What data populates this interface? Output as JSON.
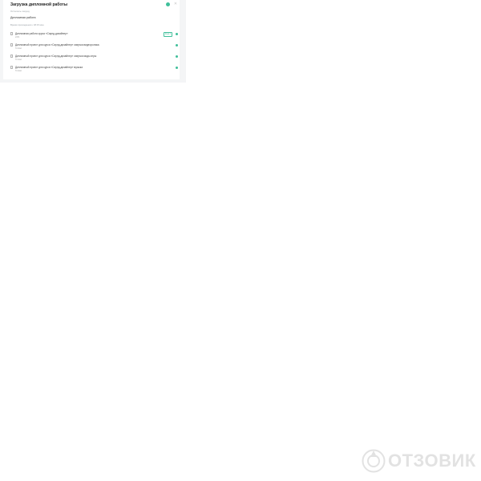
{
  "upload": {
    "title": "Загрузка дипломной работы",
    "subtitle": "Осталось секунд",
    "section_title": "Дипломная работа",
    "section_meta": "Время прохождения • 48:15 мин",
    "files": [
      {
        "name": "Дипломная работа курса «Саунд-дизайнер»",
        "status": "22%",
        "badge": "Ещё 1"
      },
      {
        "name": "Дипломный проект для курса «Саунд-дизайнер» озвучка видеоролика",
        "status": "Готово",
        "badge": ""
      },
      {
        "name": "Дипломный проект для курса «Саунд-дизайнер» озвучка моды игры",
        "status": "Готово",
        "badge": ""
      },
      {
        "name": "Дипломный проект для курса «Саунд-дизайнер» музыка",
        "status": "Готово",
        "badge": ""
      }
    ]
  },
  "close_icon": "close-icon",
  "status_icon": "check-circle-icon",
  "watermark": {
    "text": "ОТЗОВИК",
    "logo_icon": "otzovik-logo-icon"
  },
  "colors": {
    "accent": "#3fbf9a",
    "panel_bg": "#f4f5f6",
    "watermark": "#9b9b9b"
  }
}
